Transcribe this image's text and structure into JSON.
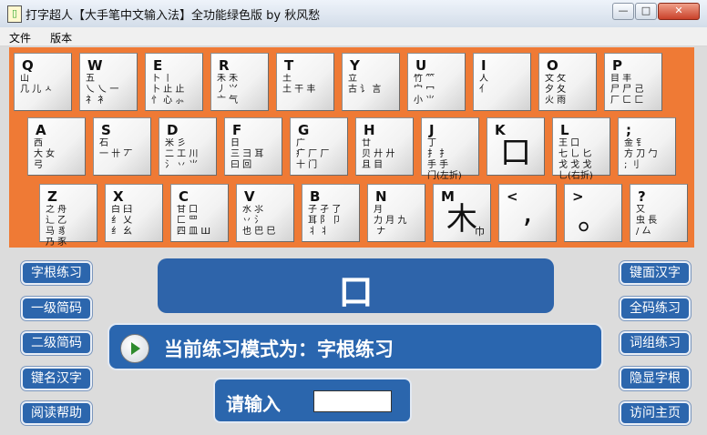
{
  "window": {
    "title": "打字超人【大手笔中文输入法】全功能绿色版 by 秋风愁",
    "app_icon": "dictionary-icon",
    "controls": {
      "minimize": "—",
      "maximize": "□",
      "close": "✕"
    }
  },
  "menubar": {
    "items": [
      "文件",
      "版本"
    ]
  },
  "keyboard": {
    "background_color": "#ef7a35",
    "keys": [
      {
        "letter": "Q",
        "roots": "山\n几 儿 ㅅ"
      },
      {
        "letter": "W",
        "roots": "五\n乀 乀 一\n礻 衤"
      },
      {
        "letter": "E",
        "roots": "卜 丨\n卜 止 止\n忄 心 ⺗"
      },
      {
        "letter": "R",
        "roots": "禾 禾\n丿 ⺍\n亠 气"
      },
      {
        "letter": "T",
        "roots": "土\n土 干 丰"
      },
      {
        "letter": "Y",
        "roots": "立\n古 讠 言"
      },
      {
        "letter": "U",
        "roots": "竹 ⺮\n宀 冖\n小 ⺌"
      },
      {
        "letter": "I",
        "roots": "人\n亻"
      },
      {
        "letter": "O",
        "roots": "文 攵\n夕 夂\n火 雨"
      },
      {
        "letter": "P",
        "roots": "目 丰\n尸 尸 己\n厂 ㄈ 匚"
      },
      {
        "letter": "A",
        "roots": "西\n大 女\n弓"
      },
      {
        "letter": "S",
        "roots": "石\n一 卄 丆"
      },
      {
        "letter": "D",
        "roots": "米 彡\n二 工 川\n氵 丷 ⺌"
      },
      {
        "letter": "F",
        "roots": "日\n三 彐 耳\n曰 回"
      },
      {
        "letter": "G",
        "roots": "广\n疒 厂 厂\n十 门"
      },
      {
        "letter": "H",
        "roots": "廿\n贝 廾 廾\n且 目"
      },
      {
        "letter": "J",
        "roots": "丁\n扌 扌\n手 手\n门(左折)"
      },
      {
        "letter": "K",
        "big": "口"
      },
      {
        "letter": "L",
        "roots": "王 口\n七 乚 匕\n戈 戈 戈\n乚(右折)"
      },
      {
        "letter": ";",
        "roots": "金 钅\n方 刀 勹\n; 刂"
      },
      {
        "letter": "Z",
        "roots": "之 舟\n辶 乙\n马 豸\n乃 豕"
      },
      {
        "letter": "X",
        "roots": "白 臼\n纟 乂\n纟 幺"
      },
      {
        "letter": "C",
        "roots": "甘 口\n匚 罒\n四 皿 Ш"
      },
      {
        "letter": "V",
        "roots": "水 ⺢\n丷 氵\n也 巴 巳"
      },
      {
        "letter": "B",
        "roots": "子 孑 了\n耳 阝 卩\n丬 丬"
      },
      {
        "letter": "N",
        "roots": "月\n力 月 九\n ナ"
      },
      {
        "letter": "M",
        "big": "木",
        "roots_sub": "巾"
      },
      {
        "letter": "<",
        "big": ","
      },
      {
        "letter": ">",
        "big": "。"
      },
      {
        "letter": "?",
        "roots": "又\n虫 長\n/ 厶"
      }
    ]
  },
  "left_buttons": [
    "字根练习",
    "一级简码",
    "二级简码",
    "键名汉字",
    "阅读帮助"
  ],
  "right_buttons": [
    "键面汉字",
    "全码练习",
    "词组练习",
    "隐显字根",
    "访问主页"
  ],
  "display": {
    "current_char": "口"
  },
  "mode": {
    "text": "当前练习模式为：字根练习",
    "icon": "play-icon"
  },
  "input": {
    "label": "请输入",
    "value": ""
  }
}
